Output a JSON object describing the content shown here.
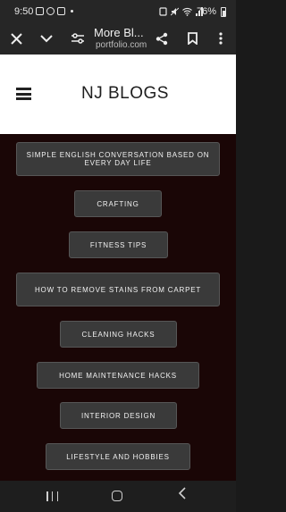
{
  "status_bar": {
    "time": "9:50",
    "battery": "76%"
  },
  "browser": {
    "title": "More Bl...",
    "url": "portfolio.com",
    "icons": [
      "close-icon",
      "chevron-down-icon",
      "site-settings-icon",
      "share-icon",
      "bookmark-icon",
      "more-vert-icon"
    ]
  },
  "header": {
    "site_title": "NJ BLOGS"
  },
  "blogs": [
    {
      "label": "SIMPLE ENGLISH CONVERSATION BASED ON EVERY DAY LIFE"
    },
    {
      "label": "CRAFTING"
    },
    {
      "label": "FITNESS TIPS"
    },
    {
      "label": "HOW TO REMOVE STAINS FROM CARPET"
    },
    {
      "label": "CLEANING HACKS"
    },
    {
      "label": "HOME MAINTENANCE HACKS"
    },
    {
      "label": "INTERIOR DESIGN"
    },
    {
      "label": "LIFESTYLE AND HOBBIES"
    }
  ],
  "colors": {
    "content_bg": "#1a0606",
    "button_bg": "#3a3a3a",
    "header_bg": "#ffffff"
  }
}
